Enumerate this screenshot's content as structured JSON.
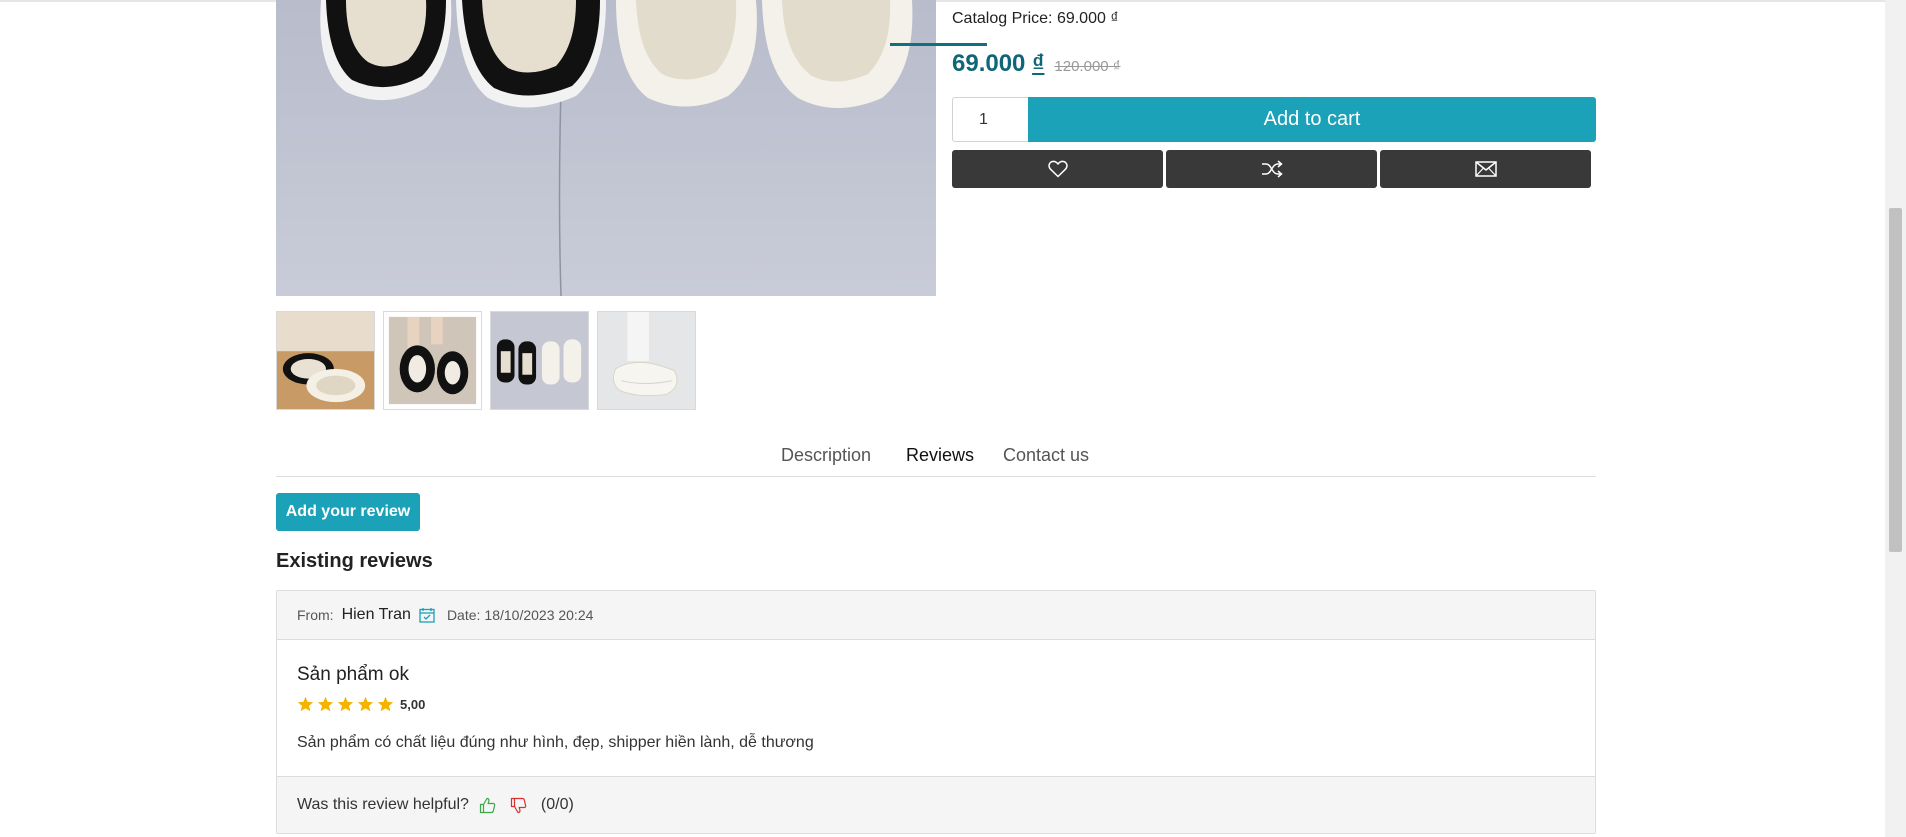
{
  "product": {
    "catalog_price_label": "Catalog Price: 69.000 ₫",
    "price_current": "69.000",
    "currency": "₫",
    "price_old": "120.000 ₫",
    "quantity": "1",
    "add_to_cart_label": "Add to cart",
    "thumbnail_count": 4
  },
  "actions": {
    "wishlist_icon": "heart-icon",
    "compare_icon": "shuffle-icon",
    "email_icon": "envelope-icon"
  },
  "tabs": [
    {
      "label": "Description",
      "active": false
    },
    {
      "label": "Reviews",
      "active": true
    },
    {
      "label": "Contact us",
      "active": false
    }
  ],
  "reviews_section": {
    "add_review_label": "Add your review",
    "existing_title": "Existing reviews"
  },
  "review": {
    "from_label": "From:",
    "author": "Hien Tran",
    "date_label": "Date:",
    "date": "18/10/2023 20:24",
    "title": "Sản phẩm ok",
    "rating": 5,
    "rating_text": "5,00",
    "text": "Sản phẩm có chất liệu đúng như hình, đẹp, shipper hiền lành, dễ thương",
    "helpful_label": "Was this review helpful?",
    "helpful_count": "(0/0)"
  },
  "colors": {
    "accent": "#1ba1b8",
    "price": "#0f6678",
    "dark_button": "#393939",
    "star": "#f5b301",
    "thumb_up": "#3aa84a",
    "thumb_down": "#d9302c"
  }
}
